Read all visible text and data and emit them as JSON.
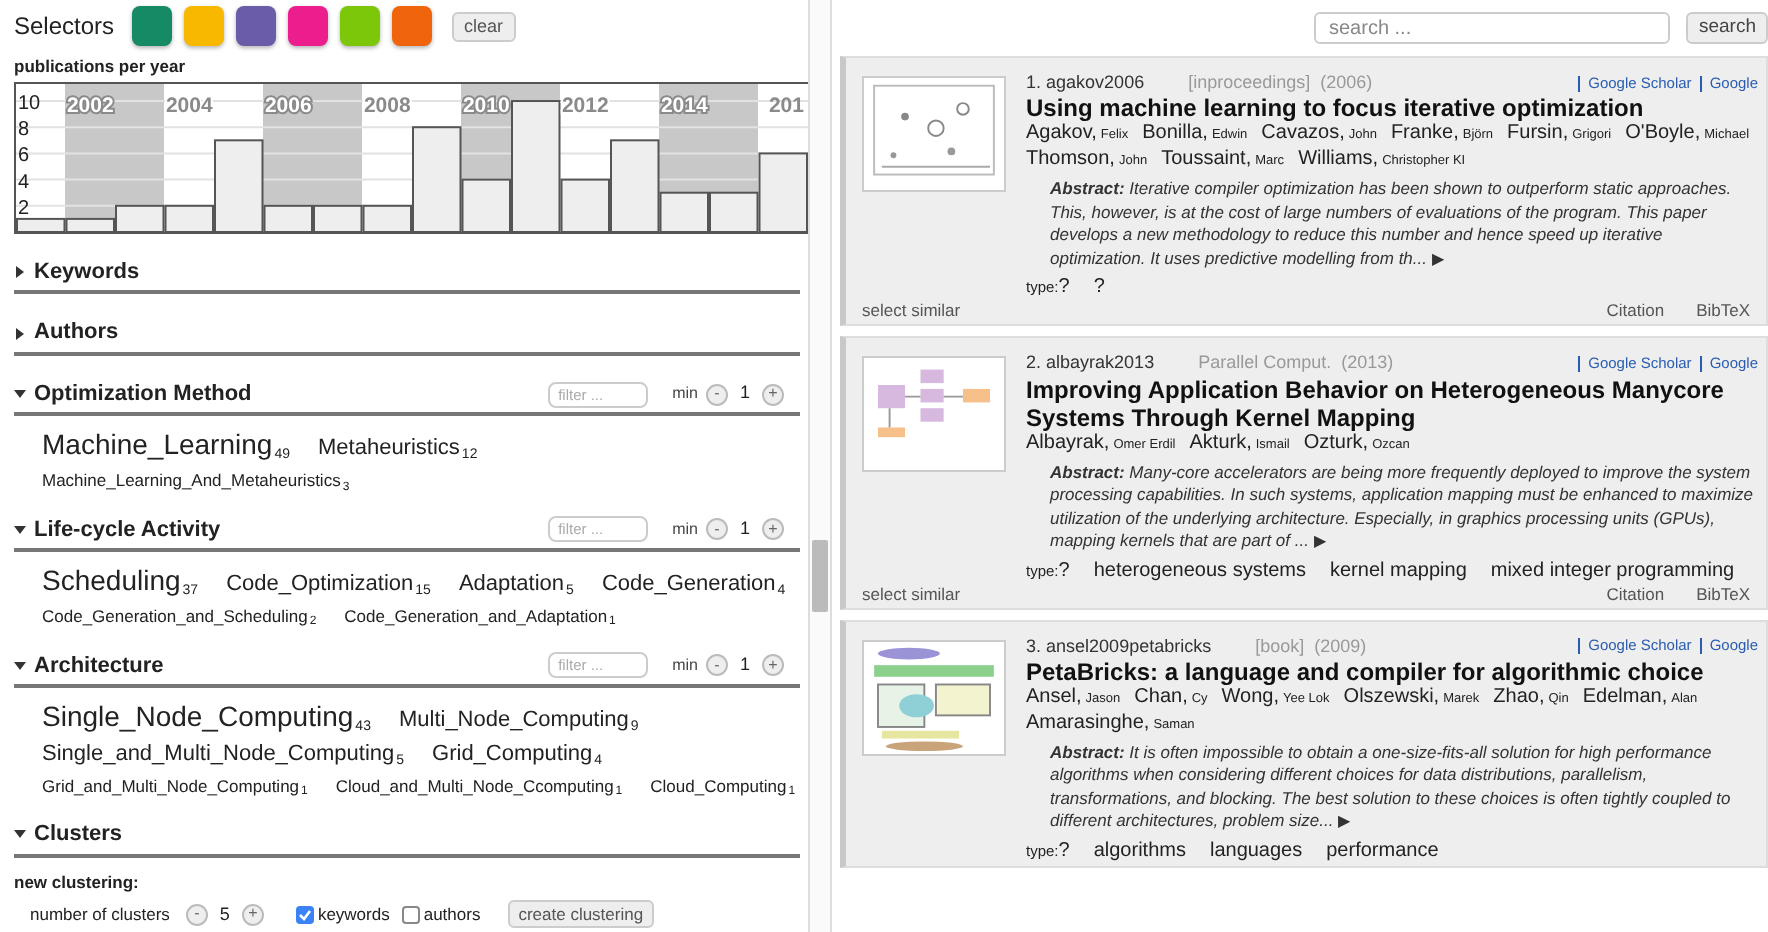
{
  "selectors": {
    "label": "Selectors",
    "swatches": [
      {
        "color": "#168a64"
      },
      {
        "color": "#f9b800"
      },
      {
        "color": "#6a5ca8"
      },
      {
        "color": "#ec1d8c"
      },
      {
        "color": "#7cc70a"
      },
      {
        "color": "#f0650b"
      }
    ],
    "clear": "clear"
  },
  "histogram": {
    "title": "publications per year",
    "chart_data": {
      "type": "bar",
      "x": [
        2001,
        2002,
        2003,
        2004,
        2005,
        2006,
        2007,
        2008,
        2009,
        2010,
        2011,
        2012,
        2013,
        2014,
        2015,
        2016
      ],
      "values": [
        1,
        1,
        2,
        2,
        7,
        2,
        2,
        2,
        8,
        4,
        10,
        4,
        7,
        3,
        3,
        6
      ],
      "xlim": [
        2000.5,
        2016.5
      ],
      "ylim": [
        0,
        11.3
      ],
      "yticks": [
        2,
        4,
        6,
        8,
        10
      ],
      "grid": true,
      "xticks": [
        2002,
        2004,
        2006,
        2008,
        2010,
        2012,
        2014
      ],
      "annotations": [
        "201"
      ]
    }
  },
  "facets": [
    {
      "title": "Keywords",
      "expanded": false
    },
    {
      "title": "Authors",
      "expanded": false
    },
    {
      "title": "Optimization Method",
      "expanded": true,
      "filter_placeholder": "filter ...",
      "min_label": "min",
      "minus": "-",
      "min_value": "1",
      "plus": "+",
      "rows": [
        [
          {
            "name": "Machine_Learning",
            "count": "49",
            "kind": "large"
          },
          {
            "name": "Metaheuristics",
            "count": "12",
            "kind": "medium"
          }
        ],
        [
          {
            "name": "Machine_Learning_And_Metaheuristics",
            "count": "3",
            "kind": "small"
          }
        ]
      ]
    },
    {
      "title": "Life-cycle Activity",
      "expanded": true,
      "filter_placeholder": "filter ...",
      "min_label": "min",
      "minus": "-",
      "min_value": "1",
      "plus": "+",
      "rows": [
        [
          {
            "name": "Scheduling",
            "count": "37",
            "kind": "large"
          },
          {
            "name": "Code_Optimization",
            "count": "15",
            "kind": "medium"
          },
          {
            "name": "Adaptation",
            "count": "5",
            "kind": "medium"
          },
          {
            "name": "Code_Generation",
            "count": "4",
            "kind": "medium"
          }
        ],
        [
          {
            "name": "Code_Generation_and_Scheduling",
            "count": "2",
            "kind": "small"
          },
          {
            "name": "Code_Generation_and_Adaptation",
            "count": "1",
            "kind": "small"
          }
        ]
      ]
    },
    {
      "title": "Architecture",
      "expanded": true,
      "filter_placeholder": "filter ...",
      "min_label": "min",
      "minus": "-",
      "min_value": "1",
      "plus": "+",
      "rows": [
        [
          {
            "name": "Single_Node_Computing",
            "count": "43",
            "kind": "large"
          },
          {
            "name": "Multi_Node_Computing",
            "count": "9",
            "kind": "medium"
          }
        ],
        [
          {
            "name": "Single_and_Multi_Node_Computing",
            "count": "5",
            "kind": "medium"
          },
          {
            "name": "Grid_Computing",
            "count": "4",
            "kind": "medium"
          }
        ],
        [
          {
            "name": "Grid_and_Multi_Node_Computing",
            "count": "1",
            "kind": "small"
          },
          {
            "name": "Cloud_and_Multi_Node_Ccomputing",
            "count": "1",
            "kind": "small"
          },
          {
            "name": "Cloud_Computing",
            "count": "1",
            "kind": "small"
          }
        ]
      ]
    }
  ],
  "clusters": {
    "title": "Clusters",
    "expanded": true,
    "heading": "new clustering:",
    "count_label": "number of clusters",
    "minus": "-",
    "value": "5",
    "plus": "+",
    "options": [
      {
        "label": "keywords",
        "checked": true
      },
      {
        "label": "authors",
        "checked": false
      }
    ],
    "button": "create clustering"
  },
  "search": {
    "placeholder": "search ...",
    "button": "search"
  },
  "publications": [
    {
      "number": "1.",
      "key": "agakov2006",
      "venue": "[inproceedings]  (2006)",
      "links": [
        "Google Scholar",
        "Google"
      ],
      "title": "Using machine learning to focus iterative optimization",
      "authors": [
        {
          "last": "Agakov,",
          "first": "Felix"
        },
        {
          "last": "Bonilla,",
          "first": "Edwin"
        },
        {
          "last": "Cavazos,",
          "first": "John"
        },
        {
          "last": "Franke,",
          "first": "Björn"
        },
        {
          "last": "Fursin,",
          "first": "Grigori"
        },
        {
          "last": "O'Boyle,",
          "first": "Michael"
        },
        {
          "last": "Thomson,",
          "first": "John"
        },
        {
          "last": "Toussaint,",
          "first": "Marc"
        },
        {
          "last": "Williams,",
          "first": "Christopher KI"
        }
      ],
      "abstract": "**Abstract:** Iterative compiler optimization has been shown to outperform static approaches. This, however, is at the cost of large numbers of evaluations of the program. This paper develops a new methodology to reduce this number and hence speed up iterative optimization. It uses predictive modelling from th...",
      "more": "▶",
      "type_label": "type:",
      "type_value": "?",
      "keywords": [
        "?"
      ],
      "select_similar": "select similar",
      "actions": [
        "Citation",
        "BibTeX"
      ],
      "kind": "picture"
    },
    {
      "number": "2.",
      "key": "albayrak2013",
      "venue": "Parallel Comput.  (2013)",
      "links": [
        "Google Scholar",
        "Google"
      ],
      "title": "Improving Application Behavior on Heterogeneous Manycore Systems Through Kernel Mapping",
      "authors": [
        {
          "last": "Albayrak,",
          "first": "Omer Erdil"
        },
        {
          "last": "Akturk,",
          "first": "Ismail"
        },
        {
          "last": "Ozturk,",
          "first": "Ozcan"
        }
      ],
      "abstract": "**Abstract:** Many-core accelerators are being more frequently deployed to improve the system processing capabilities. In such systems, application mapping must be enhanced to maximize utilization of the underlying architecture. Especially, in graphics processing units (GPUs), mapping kernels that are part of ...",
      "more": "▶",
      "type_label": "type:",
      "type_value": "?",
      "keywords": [
        "heterogeneous systems",
        "kernel mapping",
        "mixed integer programming"
      ],
      "select_similar": "select similar",
      "actions": [
        "Citation",
        "BibTeX"
      ],
      "kind": "picture"
    },
    {
      "number": "3.",
      "key": "ansel2009petabricks",
      "venue": "[book]  (2009)",
      "links": [
        "Google Scholar",
        "Google"
      ],
      "title": "PetaBricks: a language and compiler for algorithmic choice",
      "authors": [
        {
          "last": "Ansel,",
          "first": "Jason"
        },
        {
          "last": "Chan,",
          "first": "Cy"
        },
        {
          "last": "Wong,",
          "first": "Yee Lok"
        },
        {
          "last": "Olszewski,",
          "first": "Marek"
        },
        {
          "last": "Zhao,",
          "first": "Qin"
        },
        {
          "last": "Edelman,",
          "first": "Alan"
        },
        {
          "last": "Amarasinghe,",
          "first": "Saman"
        }
      ],
      "abstract": "**Abstract:** It is often impossible to obtain a one-size-fits-all solution for high performance algorithms when considering different choices for data distributions, parallelism, transformations, and blocking. The best solution to these choices is often tightly coupled to different architectures, problem size...",
      "more": "▶",
      "type_label": "type:",
      "type_value": "?",
      "keywords": [
        "algorithms",
        "languages",
        "performance"
      ],
      "kind": "picture"
    }
  ]
}
